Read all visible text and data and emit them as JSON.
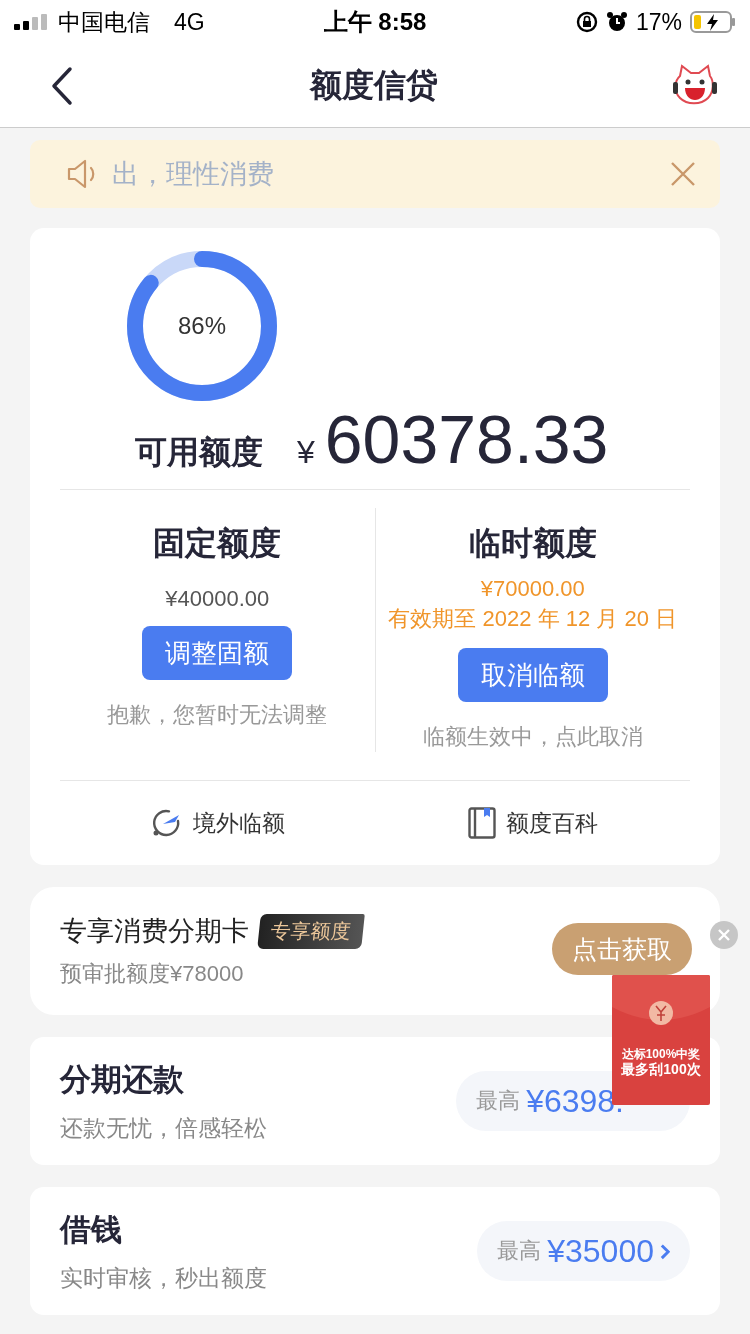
{
  "status_bar": {
    "carrier": "中国电信",
    "network": "4G",
    "time": "上午 8:58",
    "battery": "17%"
  },
  "nav": {
    "title": "额度信贷"
  },
  "notice": {
    "text": "出，理性消费"
  },
  "credit": {
    "usage": {
      "level": 0.86,
      "reading": "86%"
    },
    "available_label": "可用额度",
    "currency": "¥",
    "available_amount": "60378.33",
    "columns": [
      {
        "title": "固定额度",
        "amount": "¥40000.00",
        "button": "调整固额",
        "note": "抱歉，您暂时无法调整"
      },
      {
        "title": "临时额度",
        "amount": "¥70000.00",
        "validity": "有效期至 2022 年 12 月 20 日",
        "button": "取消临额",
        "note": "临额生效中，点此取消"
      }
    ],
    "links": [
      {
        "kind": "plane",
        "label": "境外临额"
      },
      {
        "kind": "book",
        "label": "额度百科"
      }
    ]
  },
  "promo": {
    "title": "专享消费分期卡",
    "tag": "专享额度",
    "subtitle": "预审批额度¥78000",
    "button": "点击获取"
  },
  "envelope": {
    "line_1": "达标100%中奖",
    "line_2": "最多刮100次"
  },
  "rows": [
    {
      "title": "分期还款",
      "subtitle": "还款无忧，倍感轻松",
      "prefix": "最高",
      "amount": "¥6398.",
      "arrow": false
    },
    {
      "title": "借钱",
      "subtitle": "实时审核，秒出额度",
      "prefix": "最高",
      "amount": "¥35000",
      "arrow": true
    }
  ]
}
